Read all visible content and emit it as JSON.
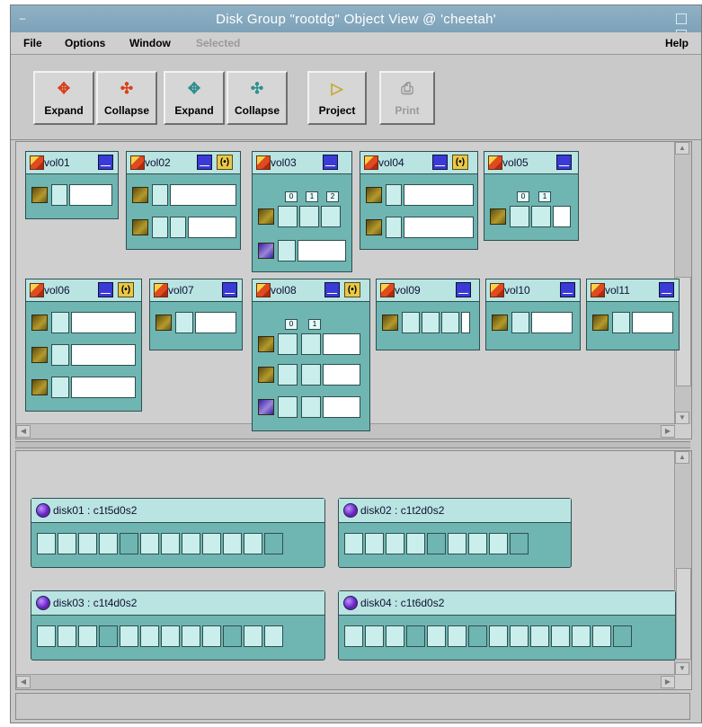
{
  "window": {
    "title": "Disk Group \"rootdg\" Object View @ 'cheetah'"
  },
  "menu": {
    "file": "File",
    "options": "Options",
    "window": "Window",
    "selected": "Selected",
    "help": "Help"
  },
  "toolbar": {
    "buttons": [
      {
        "label": "Expand",
        "icon": "expand-volumes-icon",
        "enabled": true
      },
      {
        "label": "Collapse",
        "icon": "collapse-volumes-icon",
        "enabled": true
      },
      {
        "label": "Expand",
        "icon": "expand-disks-icon",
        "enabled": true
      },
      {
        "label": "Collapse",
        "icon": "collapse-disks-icon",
        "enabled": true
      },
      {
        "label": "Project",
        "icon": "project-icon",
        "enabled": true
      },
      {
        "label": "Print",
        "icon": "printer-icon",
        "enabled": false
      }
    ]
  },
  "volumes": [
    {
      "name": "vol01"
    },
    {
      "name": "vol02"
    },
    {
      "name": "vol03"
    },
    {
      "name": "vol04"
    },
    {
      "name": "vol05"
    },
    {
      "name": "vol06"
    },
    {
      "name": "vol07"
    },
    {
      "name": "vol08"
    },
    {
      "name": "vol09"
    },
    {
      "name": "vol10"
    },
    {
      "name": "vol11"
    }
  ],
  "columns": {
    "vol03": [
      "0",
      "1",
      "2"
    ],
    "vol05": [
      "0",
      "1"
    ],
    "vol08": [
      "0",
      "1"
    ]
  },
  "disks": [
    {
      "name": "disk01 : c1t5d0s2"
    },
    {
      "name": "disk02 : c1t2d0s2"
    },
    {
      "name": "disk03 : c1t4d0s2"
    },
    {
      "name": "disk04 : c1t6d0s2"
    }
  ],
  "colors": {
    "title_bar": "#7da2b8",
    "object_fill": "#6fb5b2",
    "object_header": "#b9e4e2",
    "subdisk_cell": "#c9eeec",
    "background": "#cfcfcf"
  }
}
